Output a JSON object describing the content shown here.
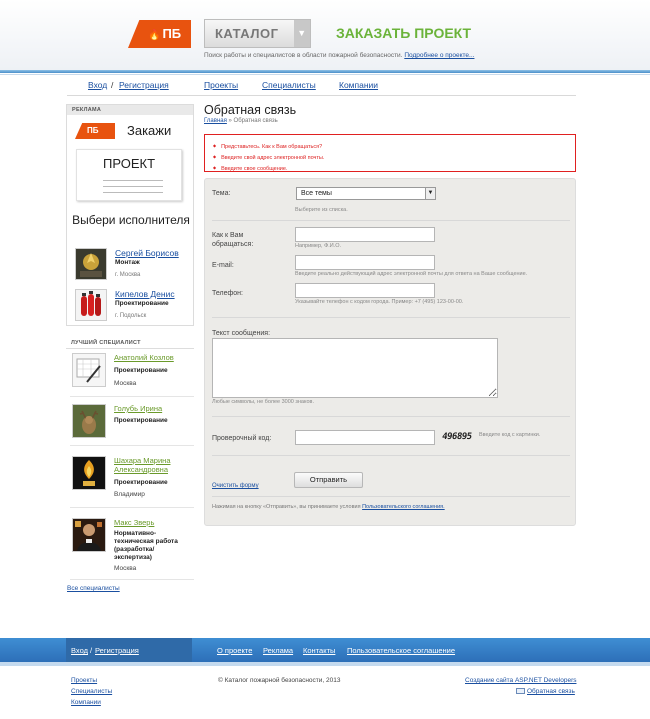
{
  "header": {
    "logo_text": "ПБ",
    "catalog_label": "КАТАЛОГ",
    "order_label": "ЗАКАЗАТЬ ПРОЕКТ",
    "tagline": "Поиск работы и специалистов в области пожарной безопасности.",
    "about_link": "Подробнее о проекте..."
  },
  "nav": {
    "login": "Вход",
    "slash": "/",
    "register": "Регистрация",
    "projects": "Проекты",
    "specialists": "Специалисты",
    "companies": "Компании"
  },
  "ad": {
    "heading": "РЕКЛАМА",
    "logo_text": "ПБ",
    "title": "Закажи",
    "card_title": "ПРОЕКТ",
    "subtitle": "Выбери исполнителя",
    "people": [
      {
        "name": "Сергей Борисов",
        "role": "Монтаж",
        "city": "г. Москва"
      },
      {
        "name": "Кипелов Денис",
        "role": "Проектирование",
        "city": "г. Подольск"
      }
    ]
  },
  "best": {
    "heading": "ЛУЧШИЙ СПЕЦИАЛИСТ",
    "items": [
      {
        "name": "Анатолий Козлов",
        "role": "Проектирование",
        "city": "Москва"
      },
      {
        "name": "Голубь Ирина",
        "role": "Проектирование",
        "city": ""
      },
      {
        "name": "Шахара Марина Александровна",
        "role": "Проектирование",
        "city": "Владимир"
      },
      {
        "name": "Макс Зверь",
        "role": "Нормативно-техническая работа (разработка/экспертиза)",
        "city": "Москва"
      }
    ],
    "all_link": "Все специалисты"
  },
  "main": {
    "title": "Обратная связь",
    "breadcrumb_home": "Главная",
    "breadcrumb_sep": "»",
    "breadcrumb_current": "Обратная связь",
    "errors": [
      "Представьтесь. Как к Вам обращаться?",
      "Введите свой адрес электронной почты.",
      "Введите свое сообщение."
    ]
  },
  "form": {
    "topic_label": "Тема:",
    "topic_value": "Все темы",
    "topic_hint": "Выберите из списка.",
    "name_label": "Как к Вам обращаться:",
    "name_value": "",
    "name_hint": "Например, Ф.И.О.",
    "email_label": "E-mail:",
    "email_value": "",
    "email_hint": "Введите реально действующий адрес электронной почты для ответа на Ваше сообщение.",
    "phone_label": "Телефон:",
    "phone_value": "",
    "phone_hint": "Указывайте телефон с кодом города. Пример: +7 (495) 123-00-00.",
    "message_label": "Текст сообщения:",
    "message_value": "",
    "message_hint": "Любые символы, не более 3000 знаков.",
    "captcha_label": "Проверочный код:",
    "captcha_value": "",
    "captcha_image_text": "496895",
    "captcha_hint": "Введите код с картинки.",
    "clear_link": "Очистить форму",
    "submit_label": "Отправить",
    "agree_text": "Нажимая на кнопку «Отправить», вы принимаете условия",
    "agree_link": "Пользовательского соглашения."
  },
  "footer": {
    "login": "Вход",
    "slash": "/",
    "register": "Регистрация",
    "about": "О проекте",
    "advert": "Реклама",
    "contacts": "Контакты",
    "agreement": "Пользовательское соглашение",
    "projects": "Проекты",
    "specialists": "Специалисты",
    "companies": "Компании",
    "copyright": "© Каталог пожарной безопасности, 2013",
    "developer": "Создание сайта ASP.NET Developers",
    "feedback": "Обратная связь"
  },
  "colors": {
    "brand_orange": "#e8530f",
    "accent_green": "#6bb33a",
    "link_blue": "#1a4fa0",
    "error_red": "#e02020",
    "footer_blue": "#2d6fb8"
  }
}
